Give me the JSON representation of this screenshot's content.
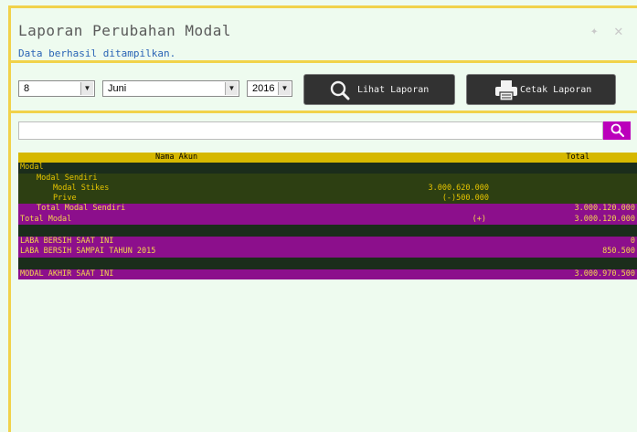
{
  "page": {
    "title": "Laporan Perubahan Modal",
    "status_message": "Data berhasil ditampilkan."
  },
  "filters": {
    "day": "8",
    "month": "Juni",
    "year": "2016",
    "view_button": "Lihat Laporan",
    "print_button": "Cetak Laporan"
  },
  "search": {
    "value": "",
    "placeholder": ""
  },
  "table": {
    "headers": [
      "Nama Akun",
      "Total"
    ],
    "rows": [
      {
        "label": "Modal",
        "mid": "",
        "total": ""
      },
      {
        "label": "Modal Sendiri",
        "mid": "",
        "total": ""
      },
      {
        "label": "Modal Stikes",
        "mid": "3.000.620.000",
        "total": ""
      },
      {
        "label": "Prive",
        "mid": "(-)500.000",
        "total": ""
      },
      {
        "label": "Total Modal Sendiri",
        "mid": "",
        "total": "3.000.120.000"
      },
      {
        "label": "Total Modal",
        "mid": "(+)",
        "total": "3.000.120.000"
      },
      {
        "label": "LABA BERSIH SAAT INI",
        "mid": "",
        "total": "0"
      },
      {
        "label": "LABA BERSIH SAMPAI TAHUN 2015",
        "mid": "",
        "total": "850.500"
      },
      {
        "label": "MODAL AKHIR SAAT INI",
        "mid": "",
        "total": "3.000.970.500"
      }
    ]
  },
  "colors": {
    "accent_yellow": "#f1d24a",
    "header_gold": "#d6b800",
    "row_dark": "#1b2d1b",
    "row_olive": "#2d3f12",
    "row_purple": "#8c0f8c",
    "search_button": "#bb00bb",
    "background": "#eefbef"
  },
  "icons": {
    "view": "magnifier-icon",
    "print": "printer-icon",
    "search": "search-icon",
    "pin": "pin-icon",
    "close": "close-icon"
  }
}
